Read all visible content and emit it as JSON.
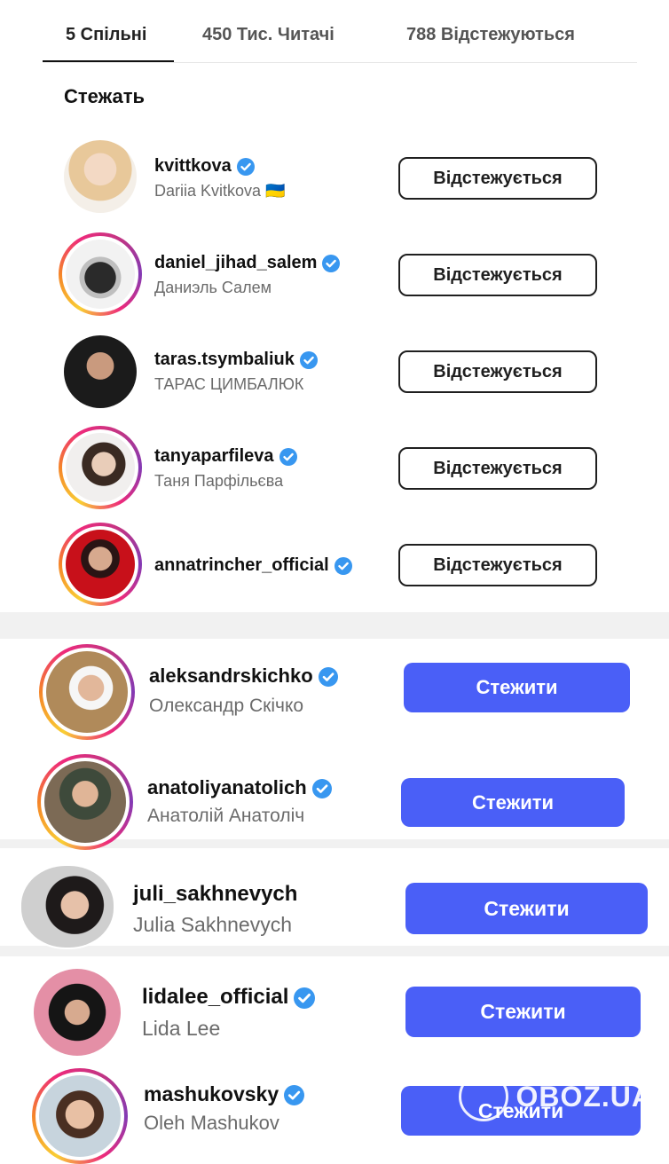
{
  "tabs": [
    {
      "label": "5 Спільні"
    },
    {
      "label": "450 Тис. Читачі"
    },
    {
      "label": "788 Відстежуються"
    }
  ],
  "section_title": "Стежать",
  "following_button_label": "Відстежується",
  "follow_button_label": "Стежити",
  "accounts": [
    {
      "username": "kvittkova",
      "full_name": "Dariia Kvitkova 🇺🇦",
      "verified": true,
      "button": "Відстежується"
    },
    {
      "username": "daniel_jihad_salem",
      "full_name": "Даниэль Салем",
      "verified": true,
      "button": "Відстежується"
    },
    {
      "username": "taras.tsymbaliuk",
      "full_name": "ТАРАС ЦИМБАЛЮК",
      "verified": true,
      "button": "Відстежується"
    },
    {
      "username": "tanyaparfileva",
      "full_name": "Таня Парфільєва",
      "verified": true,
      "button": "Відстежується"
    },
    {
      "username": "annatrincher_official",
      "full_name": "",
      "verified": true,
      "button": "Відстежується"
    },
    {
      "username": "aleksandrskichko",
      "full_name": "Олександр Скічко",
      "verified": true,
      "button": "Стежити"
    },
    {
      "username": "anatoliyanatolich",
      "full_name": "Анатолій Анатоліч",
      "verified": true,
      "button": "Стежити"
    },
    {
      "username": "juli_sakhnevych",
      "full_name": "Julia Sakhnevych",
      "verified": false,
      "button": "Стежити"
    },
    {
      "username": "lidalee_official",
      "full_name": "Lida Lee",
      "verified": true,
      "button": "Стежити"
    },
    {
      "username": "mashukovsky",
      "full_name": "Oleh Mashukov",
      "verified": true,
      "button": "Стежити"
    }
  ],
  "watermark": "OBOZ.UA",
  "colors": {
    "follow_blue": "#4a5ff7",
    "verified_blue": "#3897f0",
    "text_secondary": "#6b6b6b"
  }
}
